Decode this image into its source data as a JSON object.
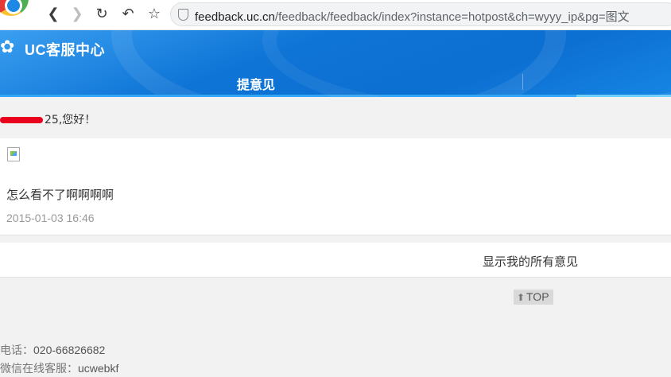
{
  "browser": {
    "url_host": "feedback.uc.cn",
    "url_path": "/feedback/feedback/index?instance=hotpost&ch=wyyy_ip&pg=图文"
  },
  "header": {
    "logo_text": "UC客服中心",
    "tab_label": "提意见"
  },
  "greeting": {
    "visible_fragment": "25",
    "suffix": ",您好！"
  },
  "feedback": {
    "text": "怎么看不了啊啊啊啊",
    "date": "2015-01-03 16:46"
  },
  "show_all_label": "显示我的所有意见",
  "top_label": "TOP",
  "footer": {
    "phone_label": "电话：",
    "phone_value": "020-66826682",
    "wechat_label": "微信在线客服：",
    "wechat_value": "ucwebkf"
  },
  "colors": {
    "header_blue": "#0c6fd2",
    "redaction": "#e8001c"
  }
}
